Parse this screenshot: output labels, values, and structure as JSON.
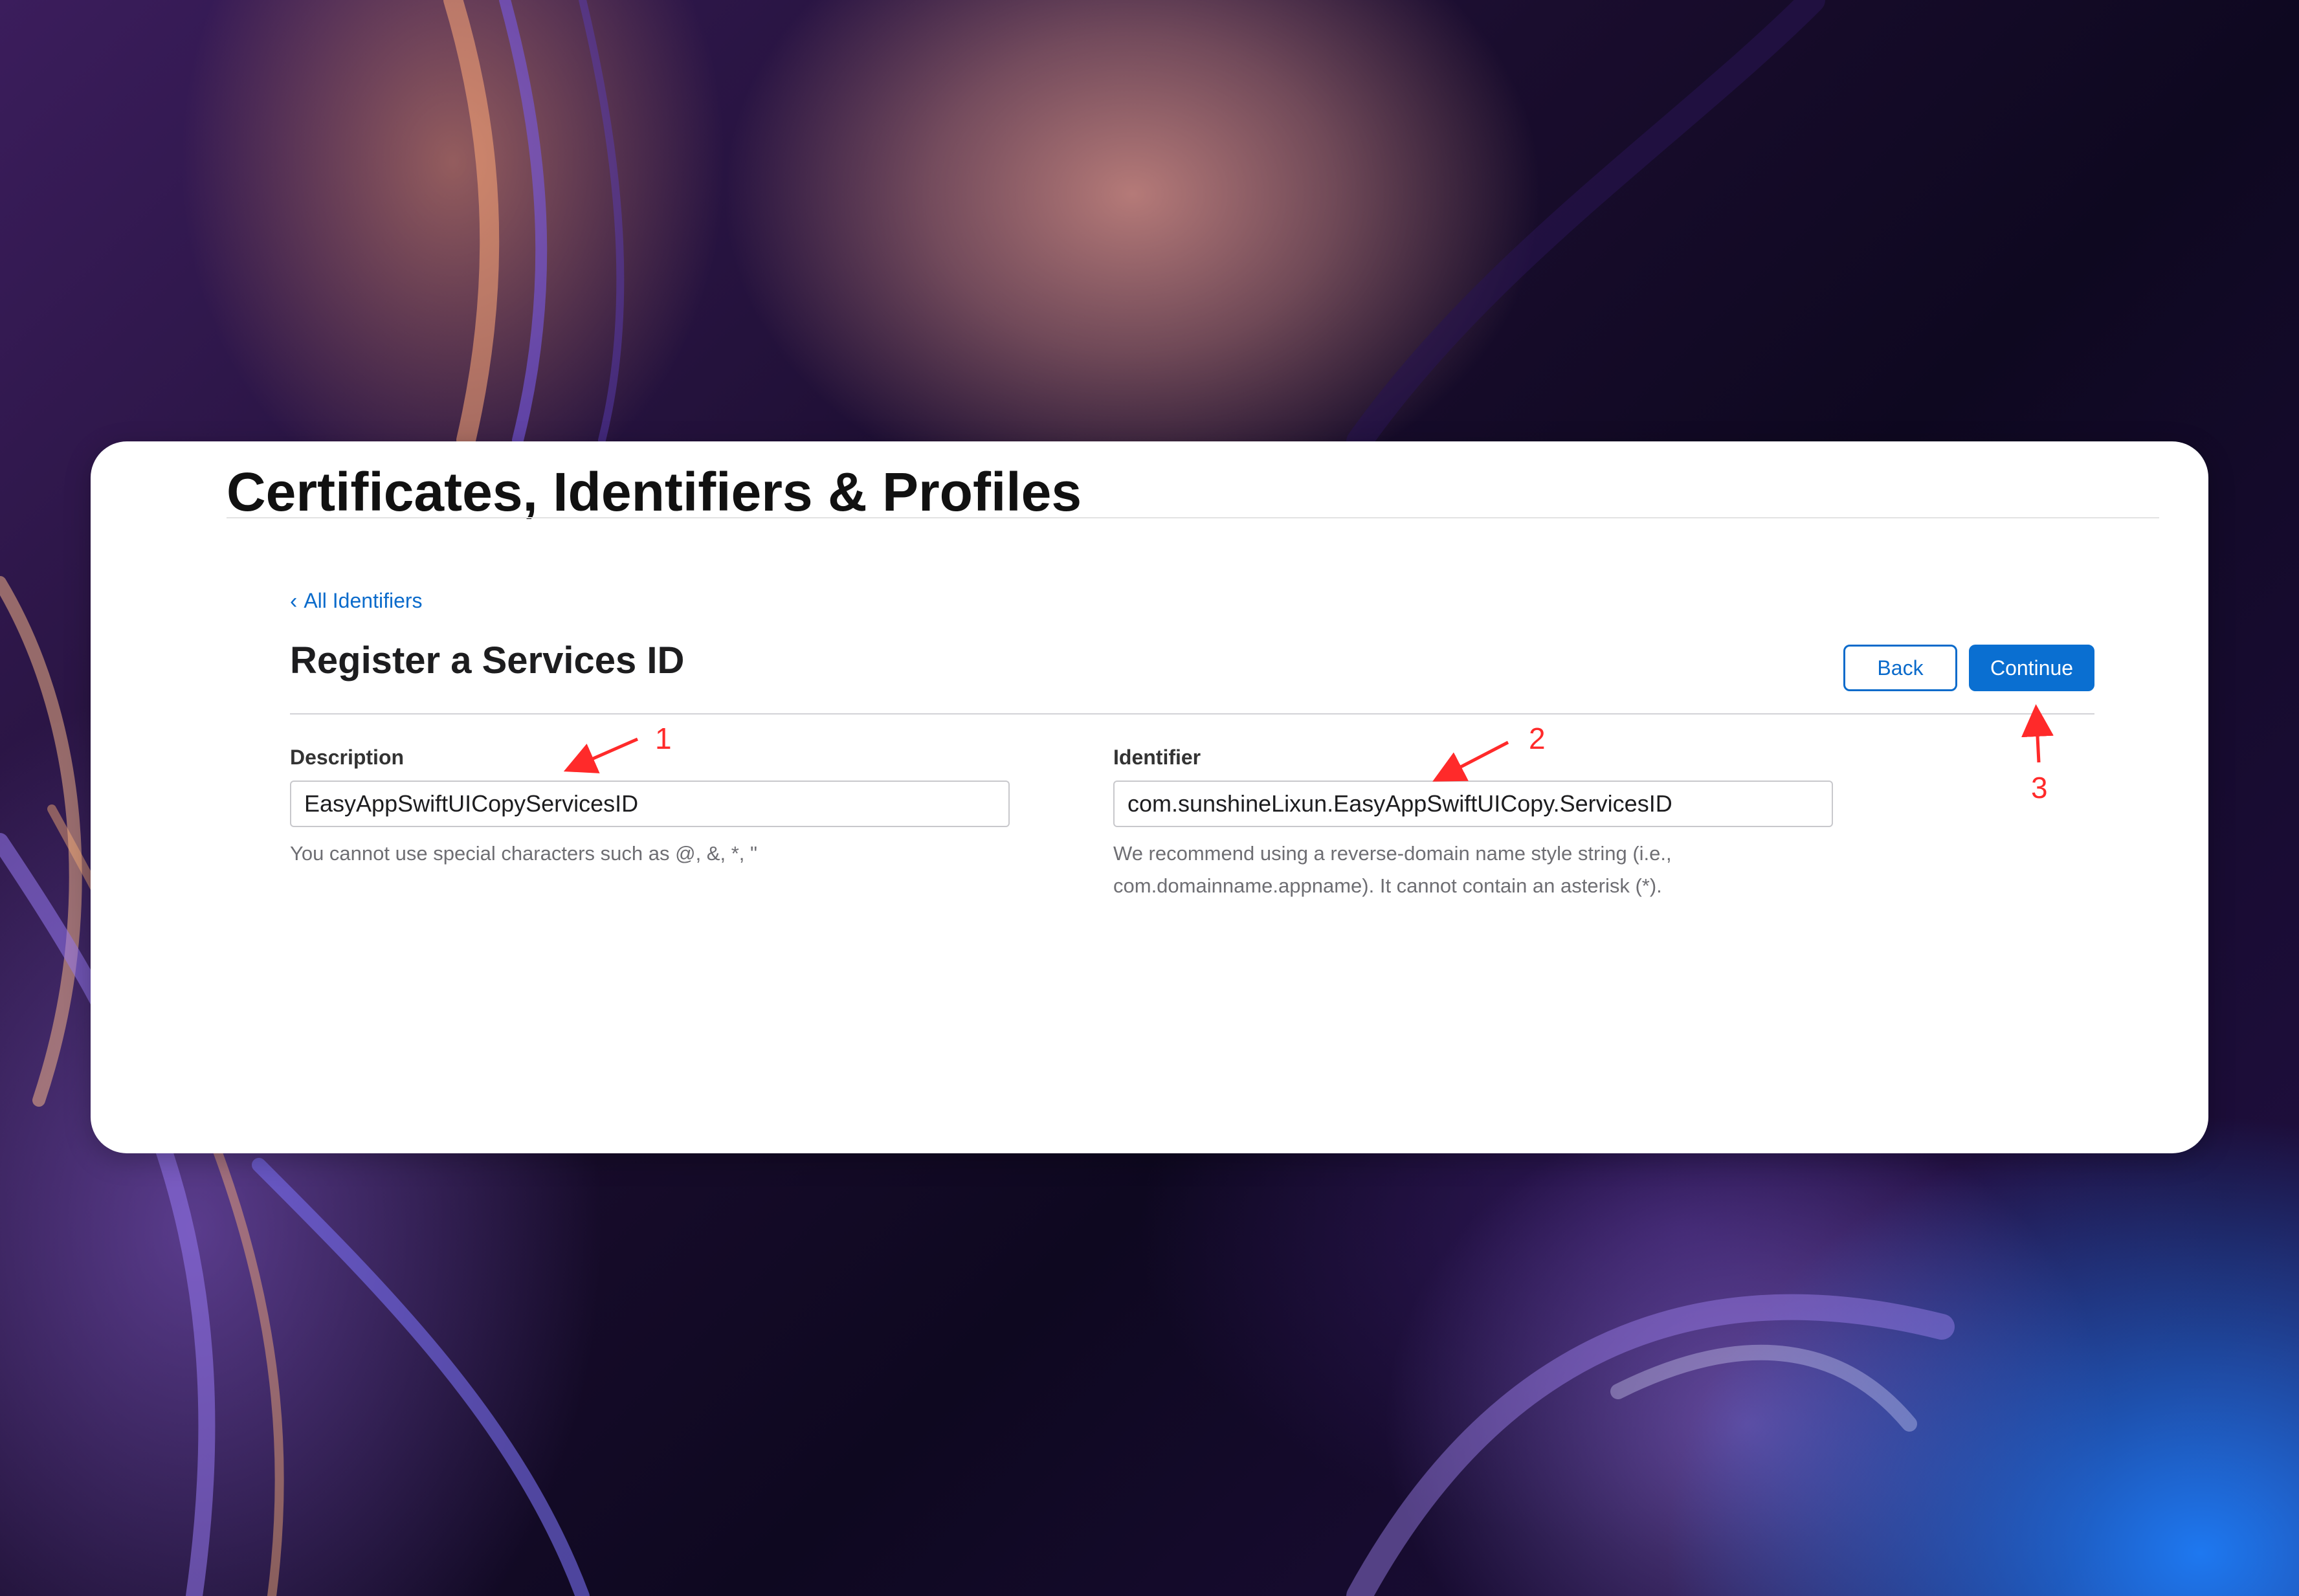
{
  "page": {
    "title": "Certificates, Identifiers & Profiles"
  },
  "nav": {
    "back_link_label": "All Identifiers",
    "back_chevron": "‹"
  },
  "section": {
    "title": "Register a Services ID",
    "back_button": "Back",
    "continue_button": "Continue"
  },
  "form": {
    "description": {
      "label": "Description",
      "value": "EasyAppSwiftUICopyServicesID",
      "help": "You cannot use special characters such as @, &, *, \""
    },
    "identifier": {
      "label": "Identifier",
      "value": "com.sunshineLixun.EasyAppSwiftUICopy.ServicesID",
      "help": "We recommend using a reverse-domain name style string (i.e., com.domainname.appname). It cannot contain an asterisk (*)."
    }
  },
  "annotations": {
    "marker_1": "1",
    "marker_2": "2",
    "marker_3": "3",
    "color": "#ff2a2a"
  },
  "colors": {
    "accent": "#0a6fd1",
    "link": "#0b6bcb"
  }
}
